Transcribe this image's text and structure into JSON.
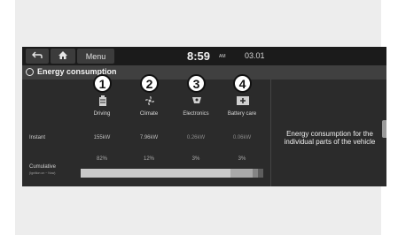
{
  "topbar": {
    "menu_label": "Menu",
    "time": "8:59",
    "ampm": "AM",
    "date": "03.01"
  },
  "title": "Energy consumption",
  "categories": [
    {
      "number": "1",
      "label": "Driving",
      "icon": "battery-drive-icon"
    },
    {
      "number": "2",
      "label": "Climate",
      "icon": "fan-icon"
    },
    {
      "number": "3",
      "label": "Electronics",
      "icon": "electronics-icon"
    },
    {
      "number": "4",
      "label": "Battery care",
      "icon": "battery-care-icon"
    }
  ],
  "rows": {
    "instant_label": "Instant",
    "instant_values": [
      "155kW",
      "7.96kW",
      "0.26kW",
      "0.06kW"
    ],
    "cumulative_label": "Cumulative",
    "cumulative_sublabel": "(Ignition on ~ Now)",
    "cumulative_percents": [
      "82%",
      "12%",
      "3%",
      "3%"
    ]
  },
  "cumulative_shares": [
    0.82,
    0.12,
    0.03,
    0.03
  ],
  "description": "Energy consumption for the individual parts of the vehicle",
  "colors": {
    "seg": [
      "#c9c9c9",
      "#a9a9a9",
      "#858585",
      "#5e5e5e"
    ]
  }
}
